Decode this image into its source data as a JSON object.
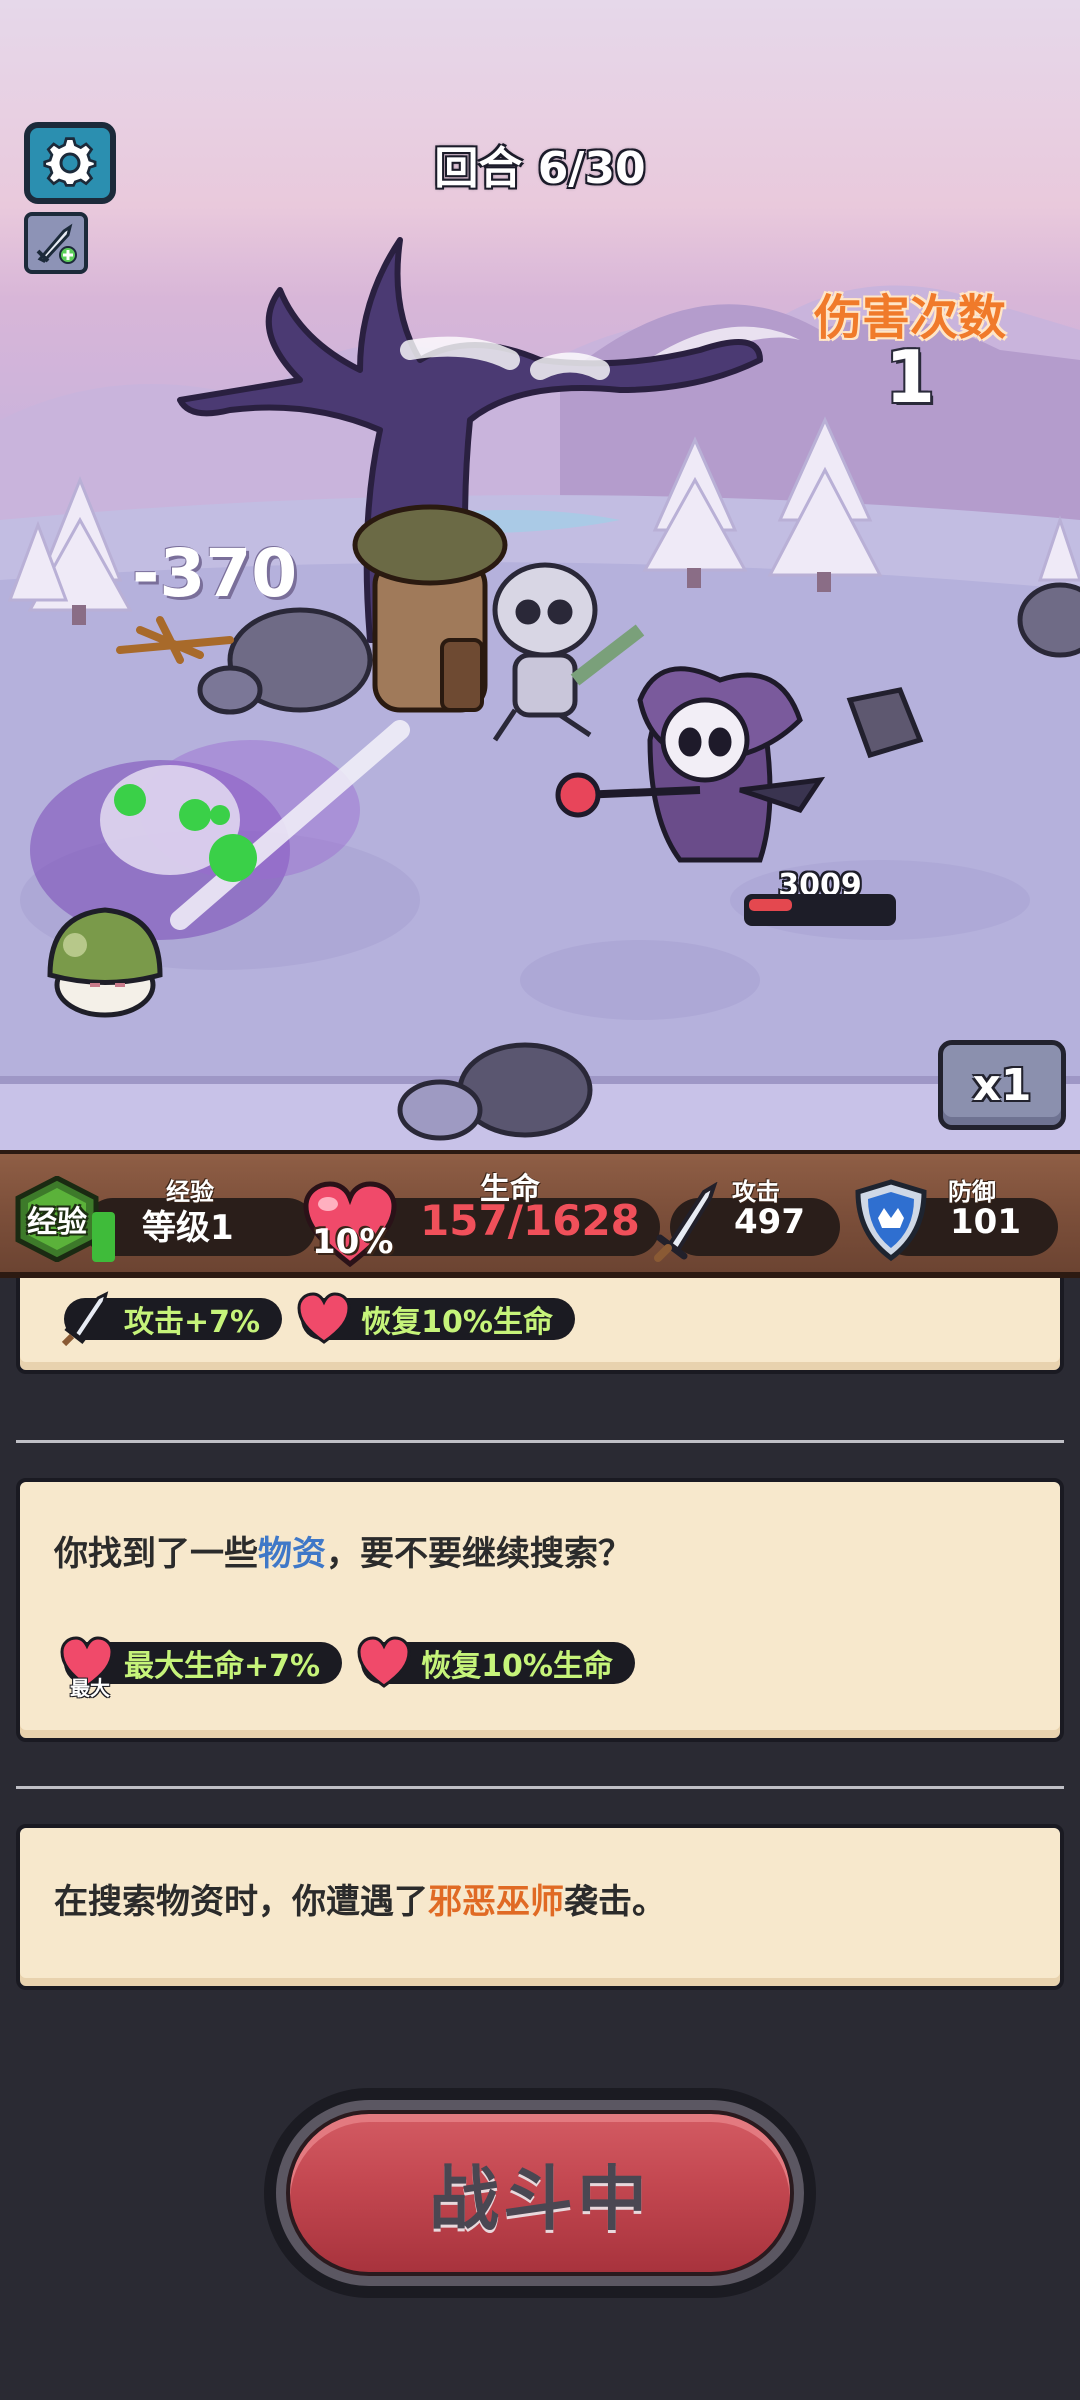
{
  "hud": {
    "round_text": "回合 6/30",
    "hit_count_title": "伤害次数",
    "hit_count_value": "1",
    "damage_popup": "-370",
    "enemy_hp": "3009",
    "enemy_hp_fraction": 0.3,
    "speed_label": "x1",
    "settings_icon": "gear-icon",
    "weapon_icon": "sword-plus-icon"
  },
  "stats": {
    "exp_badge": "经验",
    "exp_label": "经验",
    "exp_fraction": 0.1,
    "level_text": "等级1",
    "hp_label": "生命",
    "hp_percent": "10%",
    "hp_text": "157/1628",
    "atk_label": "攻击",
    "atk_value": "497",
    "def_label": "防御",
    "def_value": "101",
    "colors": {
      "hp": "#f0505a",
      "exp": "#3fbb3a",
      "buff_text": "#c6f47a"
    }
  },
  "log": {
    "card1": {
      "tags": [
        {
          "icon": "sword-icon",
          "text": "攻击+7%"
        },
        {
          "icon": "heart-icon",
          "text": "恢复10%生命"
        }
      ]
    },
    "card2": {
      "text_before": "你找到了一些",
      "text_highlight": "物资",
      "text_after": "，要不要继续搜索？",
      "tags": [
        {
          "icon": "heart-max-icon",
          "max_label": "最大",
          "text": "最大生命+7%"
        },
        {
          "icon": "heart-icon",
          "text": "恢复10%生命"
        }
      ]
    },
    "card3": {
      "text_before": "在搜索物资时，你遭遇了",
      "text_highlight": "邪恶巫师",
      "text_after": "袭击。"
    }
  },
  "action": {
    "button_label": "战斗中"
  }
}
